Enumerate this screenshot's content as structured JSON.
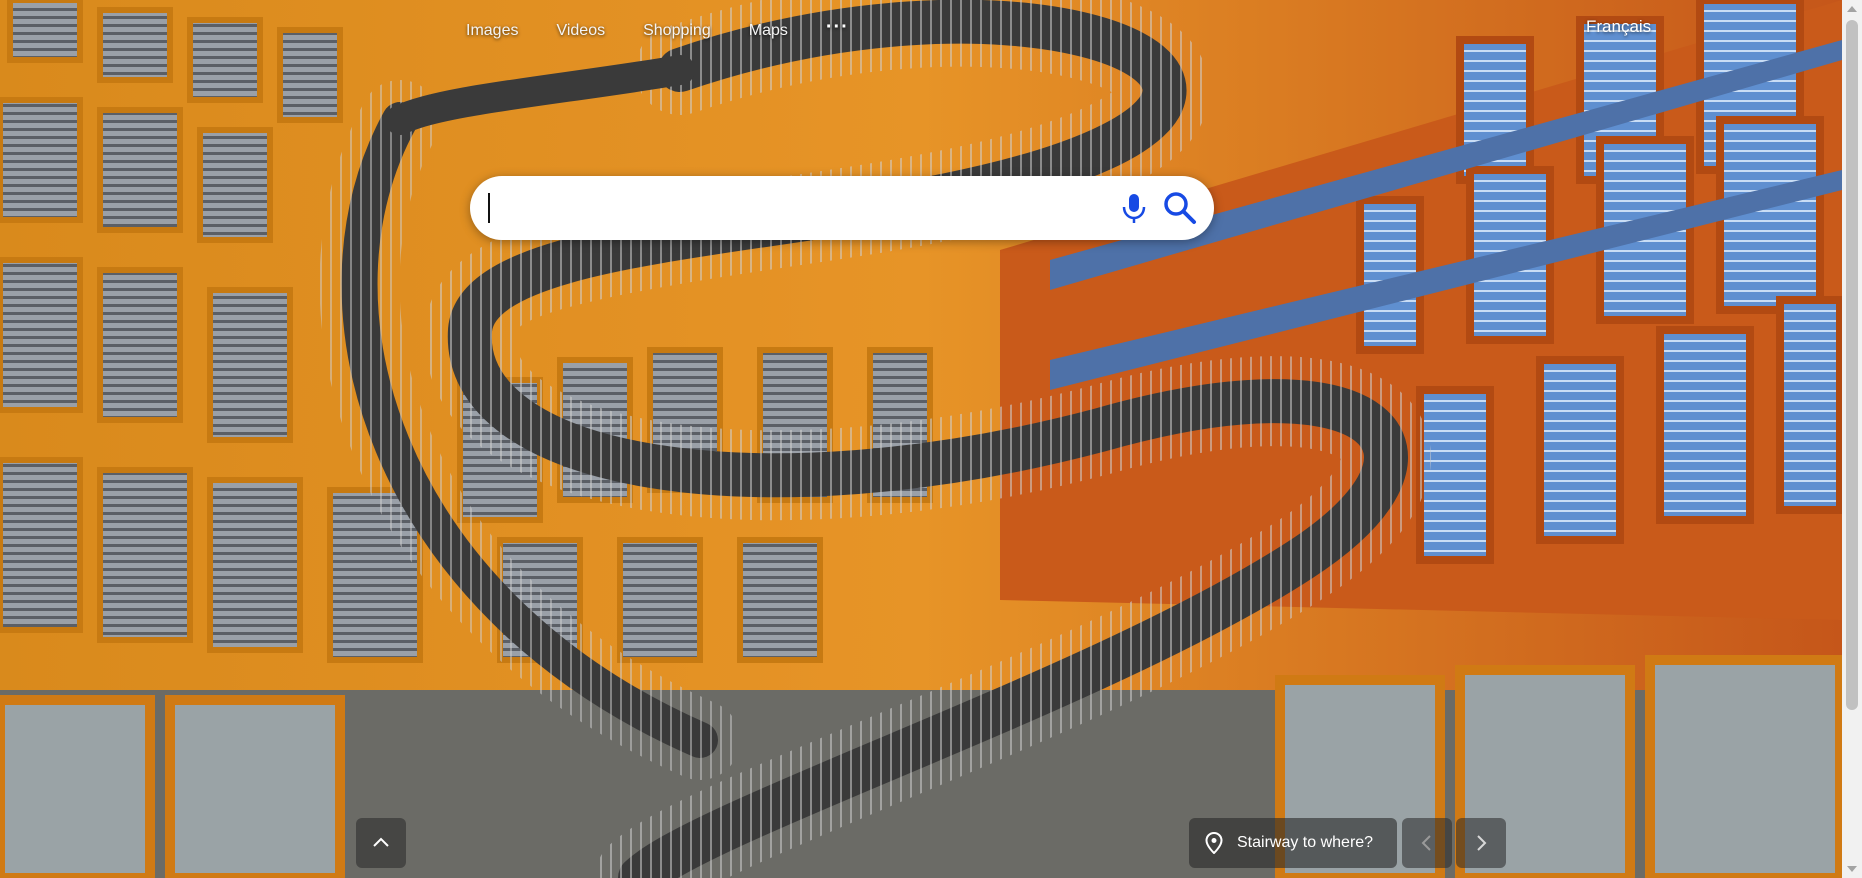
{
  "nav": {
    "links": [
      "Images",
      "Videos",
      "Shopping",
      "Maps"
    ],
    "more_label": "···",
    "language_label": "Français"
  },
  "search": {
    "value": "",
    "placeholder": ""
  },
  "background": {
    "caption": "Stairway to where?"
  },
  "icons": {
    "mic": "microphone-icon",
    "search": "search-icon",
    "collapse": "chevron-up-icon",
    "location": "location-pin-icon",
    "prev": "chevron-left-icon",
    "next": "chevron-right-icon"
  },
  "colors": {
    "accent": "#174ae4",
    "facade_orange": "#e8891a",
    "stair_dark": "#3a3a3a"
  }
}
